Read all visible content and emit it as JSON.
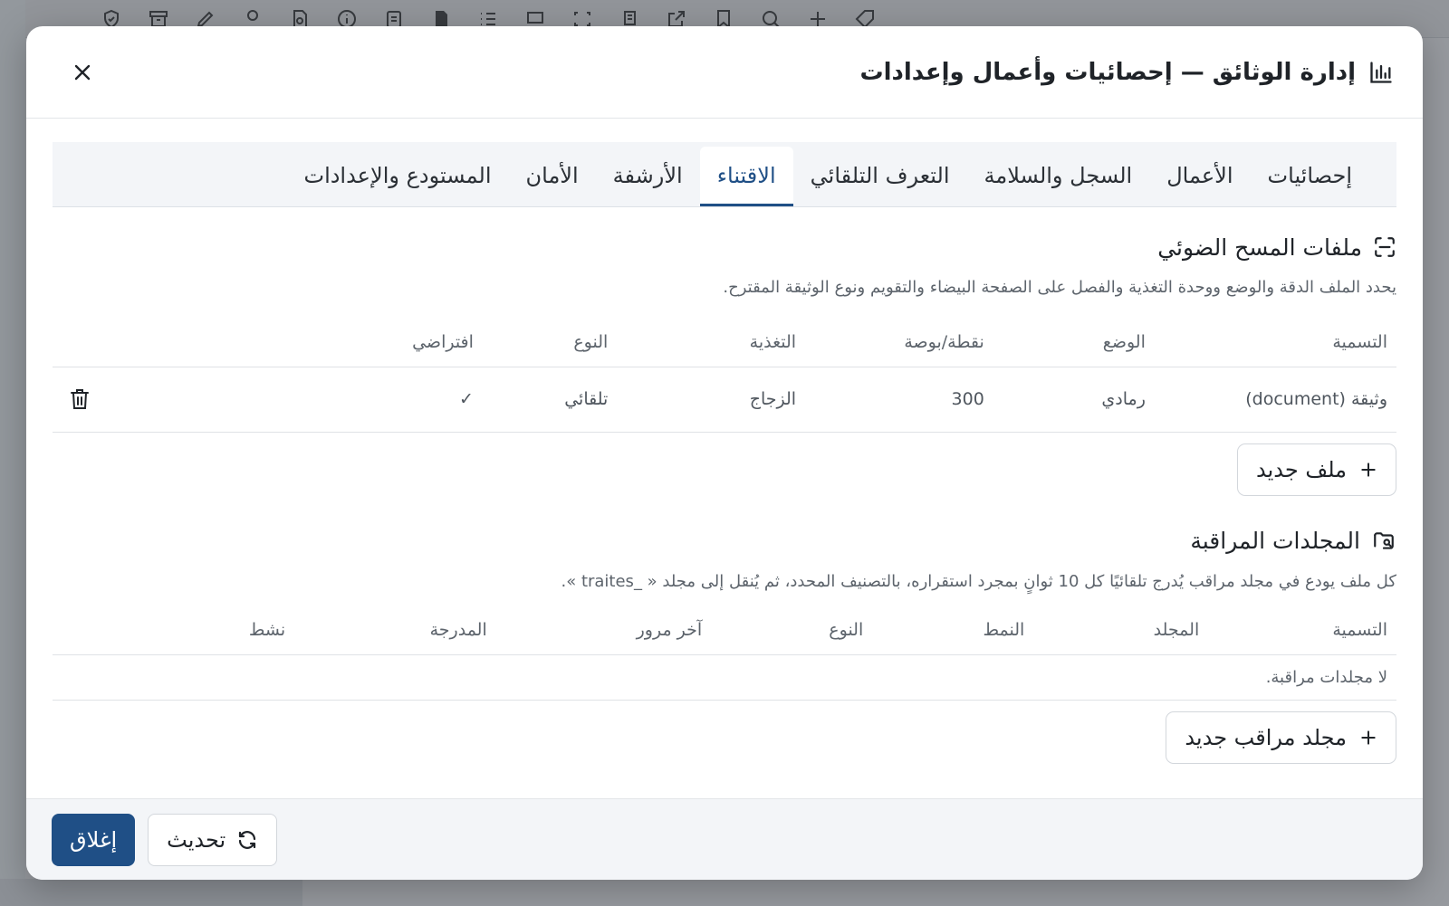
{
  "modal": {
    "title": "إدارة الوثائق — إحصائيات وأعمال وإعدادات",
    "title_icon": "bar-chart-icon",
    "close_icon": "close-icon"
  },
  "tabs": [
    {
      "label": "إحصائيات",
      "active": false
    },
    {
      "label": "الأعمال",
      "active": false
    },
    {
      "label": "السجل والسلامة",
      "active": false
    },
    {
      "label": "التعرف التلقائي",
      "active": false
    },
    {
      "label": "الاقتناء",
      "active": true
    },
    {
      "label": "الأرشفة",
      "active": false
    },
    {
      "label": "الأمان",
      "active": false
    },
    {
      "label": "المستودع والإعدادات",
      "active": false
    }
  ],
  "scan_profiles": {
    "title": "ملفات المسح الضوئي",
    "icon": "scan-icon",
    "description": "يحدد الملف الدقة والوضع ووحدة التغذية والفصل على الصفحة البيضاء والتقويم ونوع الوثيقة المقترح.",
    "columns": {
      "name": "التسمية",
      "mode": "الوضع",
      "dpi": "نقطة/بوصة",
      "feeder": "التغذية",
      "type": "النوع",
      "default": "افتراضي"
    },
    "rows": [
      {
        "name": "وثيقة (document)",
        "mode": "رمادي",
        "dpi": "300",
        "feeder": "الزجاج",
        "type": "تلقائي",
        "default": "✓"
      }
    ],
    "new_button": "ملف جديد"
  },
  "watched_folders": {
    "title": "المجلدات المراقبة",
    "icon": "folder-search-icon",
    "description": "كل ملف يودع في مجلد مراقب يُدرج تلقائيًا كل 10 ثوانٍ بمجرد استقراره، بالتصنيف المحدد، ثم يُنقل إلى مجلد « _traites ».",
    "columns": {
      "name": "التسمية",
      "folder": "المجلد",
      "pattern": "النمط",
      "type": "النوع",
      "last_pass": "آخر مرور",
      "inserted": "المدرجة",
      "active": "نشط"
    },
    "empty_text": "لا مجلدات مراقبة.",
    "new_button": "مجلد مراقب جديد"
  },
  "footer": {
    "close_label": "إغلاق",
    "refresh_label": "تحديث"
  },
  "colors": {
    "primary": "#1f4f86",
    "overlay": "rgba(40,46,56,0.45)"
  }
}
